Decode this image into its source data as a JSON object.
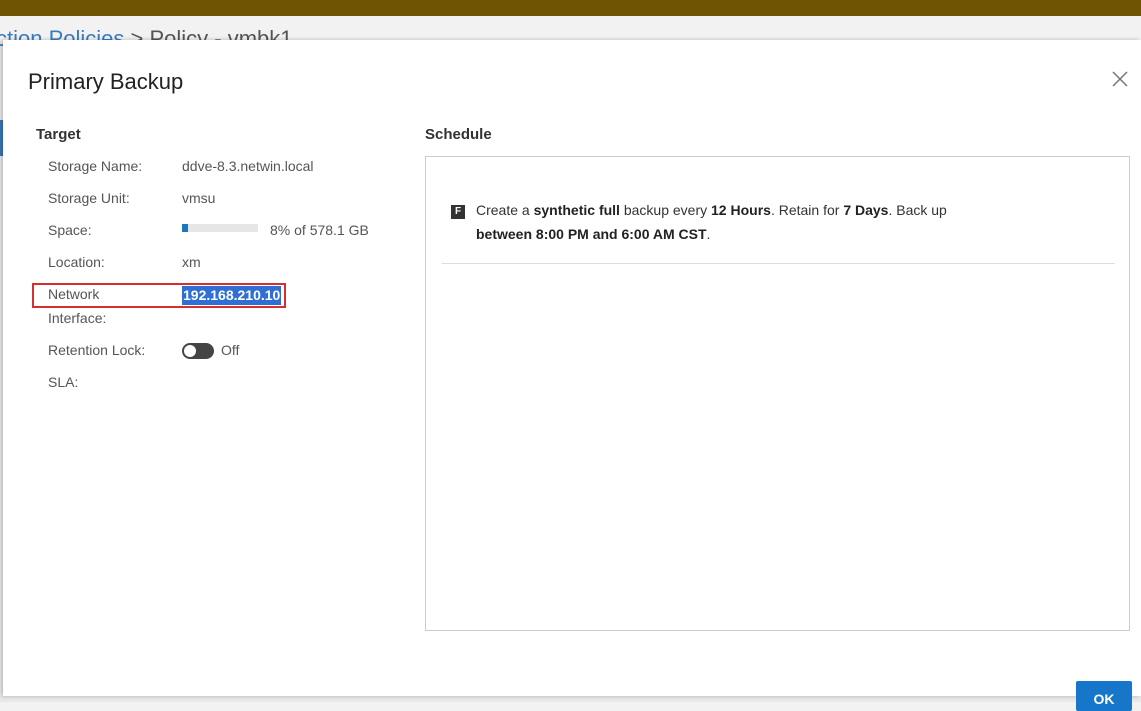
{
  "background": {
    "breadcrumb_link": "ction Policies",
    "breadcrumb_sep": ">",
    "breadcrumb_current": "Policy - vmbk1"
  },
  "dialog": {
    "title": "Primary Backup",
    "close_icon": "close-icon",
    "ok_label": "OK"
  },
  "target": {
    "heading": "Target",
    "storage_name_label": "Storage Name:",
    "storage_name_value": "ddve-8.3.netwin.local",
    "storage_unit_label": "Storage Unit:",
    "storage_unit_value": "vmsu",
    "space_label": "Space:",
    "space_percent": 8,
    "space_text": "8% of 578.1 GB",
    "location_label": "Location:",
    "location_value": "xm",
    "network_label_line1": "Network",
    "network_label_line2": "Interface:",
    "network_value": "192.168.210.10",
    "retention_label": "Retention Lock:",
    "retention_state": "Off",
    "sla_label": "SLA:"
  },
  "schedule": {
    "heading": "Schedule",
    "badge": "F",
    "text_1": "Create a ",
    "text_bold_1": "synthetic full",
    "text_2": " backup every ",
    "text_bold_2": "12 Hours",
    "text_3": ". Retain for ",
    "text_bold_3": "7 Days",
    "text_4": ". Back up",
    "text_bold_4": "between 8:00 PM and 6:00 AM CST",
    "text_5": "."
  },
  "colors": {
    "accent": "#1676c9",
    "highlight_border": "#d62f2f",
    "selection": "#2f6fd4",
    "topbar": "#6e5403"
  }
}
